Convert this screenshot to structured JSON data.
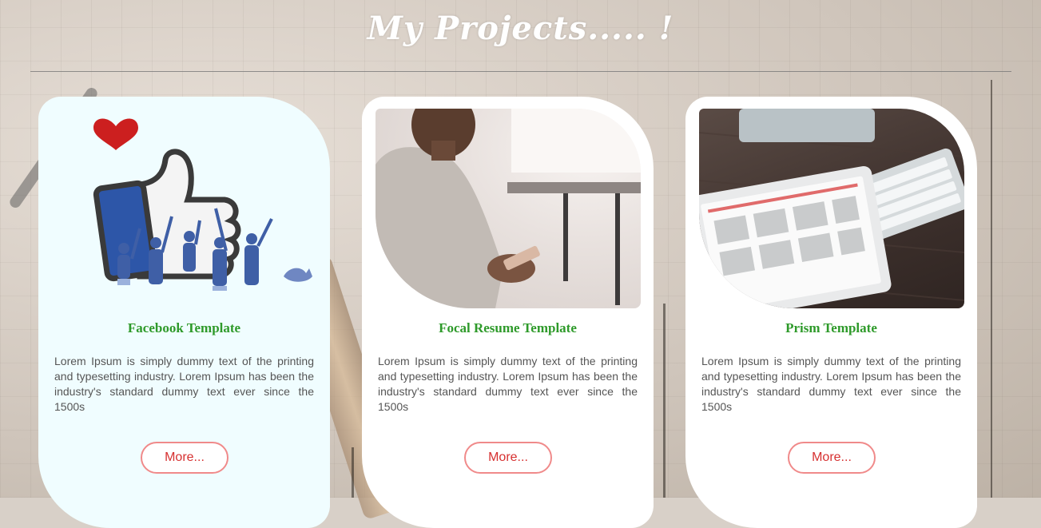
{
  "page": {
    "title": "My Projects..... !"
  },
  "projects": [
    {
      "name": "Facebook Template",
      "image": "facebook-like-illustration",
      "description": "Lorem Ipsum is simply dummy text of the printing and typesetting industry. Lorem Ipsum has been the industry's standard dummy text ever since the 1500s",
      "button_label": "More..."
    },
    {
      "name": "Focal Resume Template",
      "image": "person-using-phone-photo",
      "description": "Lorem Ipsum is simply dummy text of the printing and typesetting industry. Lorem Ipsum has been the industry's standard dummy text ever since the 1500s",
      "button_label": "More..."
    },
    {
      "name": "Prism Template",
      "image": "tablet-and-keyboard-photo",
      "description": "Lorem Ipsum is simply dummy text of the printing and typesetting industry. Lorem Ipsum has been the industry's standard dummy text ever since the 1500s",
      "button_label": "More..."
    }
  ],
  "colors": {
    "heading_green": "#2e9a2a",
    "button_border": "#f08a8a",
    "button_text": "#d63030"
  }
}
